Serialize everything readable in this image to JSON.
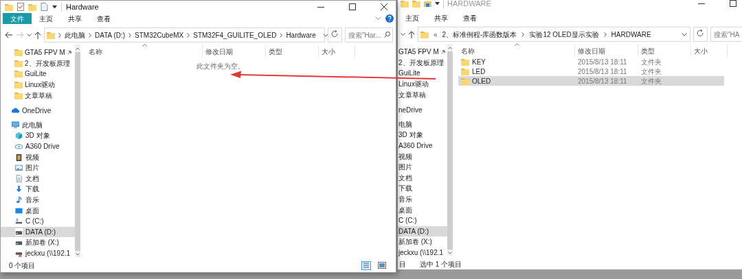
{
  "windows": [
    {
      "kind": "front",
      "title": "Hardware",
      "ribbon_tabs": [
        {
          "label": "文件",
          "selected": true
        },
        {
          "label": "主页",
          "selected": false
        },
        {
          "label": "共享",
          "selected": false
        },
        {
          "label": "查看",
          "selected": false
        }
      ],
      "address": {
        "path": [
          "此电脑",
          "DATA (D:)",
          "STM32CubeMX",
          "STM32F4_GUILITE_OLED",
          "Hardware"
        ]
      },
      "search": {
        "placeholder": "搜索\"Har..."
      },
      "sidebar": {
        "quick_access": [
          {
            "label": "GTA5 FPV M",
            "pinned": true
          },
          {
            "label": "2、开发板原理",
            "pinned": false
          },
          {
            "label": "GuiLite",
            "pinned": false
          },
          {
            "label": "Linux驱动",
            "pinned": false
          },
          {
            "label": "文章草稿",
            "pinned": false
          }
        ],
        "nodes": [
          {
            "label": "OneDrive",
            "kind": "cloud",
            "selected": false
          },
          {
            "label": "此电脑",
            "kind": "pc",
            "selected": false,
            "children": [
              {
                "label": "3D 对象",
                "kind": "cube",
                "selected": false
              },
              {
                "label": "A360 Drive",
                "kind": "a360",
                "selected": false
              },
              {
                "label": "视频",
                "kind": "video",
                "selected": false
              },
              {
                "label": "图片",
                "kind": "picture",
                "selected": false
              },
              {
                "label": "文档",
                "kind": "document",
                "selected": false
              },
              {
                "label": "下载",
                "kind": "download",
                "selected": false
              },
              {
                "label": "音乐",
                "kind": "music",
                "selected": false
              },
              {
                "label": "桌面",
                "kind": "desktop",
                "selected": false
              },
              {
                "label": "C (C:)",
                "kind": "system-drive",
                "selected": false
              },
              {
                "label": "DATA (D:)",
                "kind": "drive",
                "selected": true
              },
              {
                "label": "新加卷 (X:)",
                "kind": "drive",
                "selected": false
              },
              {
                "label": "jeckxu (\\\\192.1",
                "kind": "network-drive",
                "selected": false
              }
            ]
          }
        ]
      },
      "columns": [
        "名称",
        "修改日期",
        "类型",
        "大小"
      ],
      "empty_message": "此文件夹为空。",
      "status": {
        "left": "0 个项目"
      }
    },
    {
      "kind": "covered",
      "title": "HARDWARE",
      "ribbon_tabs": [
        {
          "label": "主页",
          "selected": false
        },
        {
          "label": "共享",
          "selected": false
        },
        {
          "label": "查看",
          "selected": false
        }
      ],
      "address": {
        "prefix": "«",
        "path": [
          "2、标准例程-库函数版本",
          "实验12 OLED显示实验",
          "HARDWARE"
        ]
      },
      "search": {
        "placeholder": "搜索\"HA"
      },
      "sidebar": {
        "quick_access": [
          {
            "label": "GTA5 FPV M",
            "pinned": true
          },
          {
            "label": "2、开发板原理",
            "pinned": false
          },
          {
            "label": "GuiLite",
            "pinned": false
          },
          {
            "label": "Linux驱动",
            "pinned": false
          },
          {
            "label": "文章草稿",
            "pinned": false
          }
        ],
        "nodes": [
          {
            "label": "neDrive",
            "kind": "cloud",
            "selected": false
          },
          {
            "label": "电脑",
            "kind": "pc",
            "selected": false,
            "children": [
              {
                "label": "3D 对象",
                "kind": "cube",
                "selected": false
              },
              {
                "label": "A360 Drive",
                "kind": "a360",
                "selected": false
              },
              {
                "label": "视频",
                "kind": "video",
                "selected": false
              },
              {
                "label": "图片",
                "kind": "picture",
                "selected": false
              },
              {
                "label": "文档",
                "kind": "document",
                "selected": false
              },
              {
                "label": "下载",
                "kind": "download",
                "selected": false
              },
              {
                "label": "音乐",
                "kind": "music",
                "selected": false
              },
              {
                "label": "桌面",
                "kind": "desktop",
                "selected": false
              },
              {
                "label": "C (C:)",
                "kind": "system-drive",
                "selected": false
              },
              {
                "label": "DATA (D:)",
                "kind": "drive",
                "selected": true
              },
              {
                "label": "新加卷 (X:)",
                "kind": "drive",
                "selected": false
              },
              {
                "label": "jeckxu (\\\\192.1",
                "kind": "network-drive",
                "selected": false
              }
            ]
          }
        ]
      },
      "columns": [
        "名称",
        "修改日期",
        "类型",
        "大小"
      ],
      "rows": [
        {
          "name": "KEY",
          "date": "2015/8/13 18:11",
          "type": "文件夹",
          "selected": false
        },
        {
          "name": "LED",
          "date": "2015/8/13 18:11",
          "type": "文件夹",
          "selected": false
        },
        {
          "name": "OLED",
          "date": "2015/8/13 18:11",
          "type": "文件夹",
          "selected": true
        }
      ],
      "status": {
        "left": "目",
        "right": "选中 1 个项目"
      }
    }
  ]
}
